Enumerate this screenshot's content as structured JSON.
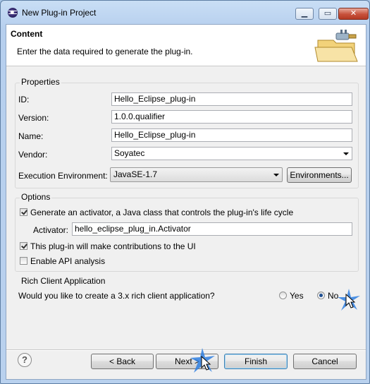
{
  "window": {
    "title": "New Plug-in Project",
    "minimize": "▁",
    "maximize": "▭",
    "close": "✕"
  },
  "header": {
    "title": "Content",
    "subtitle": "Enter the data required to generate the plug-in.",
    "banner_icon": "folder-plug-icon"
  },
  "properties": {
    "label": "Properties",
    "id_label": "ID:",
    "id_value": "Hello_Eclipse_plug-in",
    "version_label": "Version:",
    "version_value": "1.0.0.qualifier",
    "name_label": "Name:",
    "name_value": "Hello_Eclipse_plug-in",
    "vendor_label": "Vendor:",
    "vendor_value": "Soyatec",
    "ee_label": "Execution Environment:",
    "ee_value": "JavaSE-1.7",
    "environments_button": "Environments..."
  },
  "options": {
    "label": "Options",
    "generate_activator": {
      "label": "Generate an activator, a Java class that controls the plug-in's life cycle",
      "checked": true
    },
    "activator_label": "Activator:",
    "activator_value": "hello_eclipse_plug_in.Activator",
    "ui_contributions": {
      "label": "This plug-in will make contributions to the UI",
      "checked": true
    },
    "api_analysis": {
      "label": "Enable API analysis",
      "checked": false
    }
  },
  "rca": {
    "label": "Rich Client Application",
    "question": "Would you like to create a 3.x rich client application?",
    "yes_label": "Yes",
    "no_label": "No",
    "selected": "No"
  },
  "buttons": {
    "help": "?",
    "back": "< Back",
    "next": "Next >",
    "finish": "Finish",
    "cancel": "Cancel"
  },
  "colors": {
    "accent": "#3c7fb1",
    "title_bar": "#b6cfee",
    "highlight_star": "#2f7fe0"
  }
}
